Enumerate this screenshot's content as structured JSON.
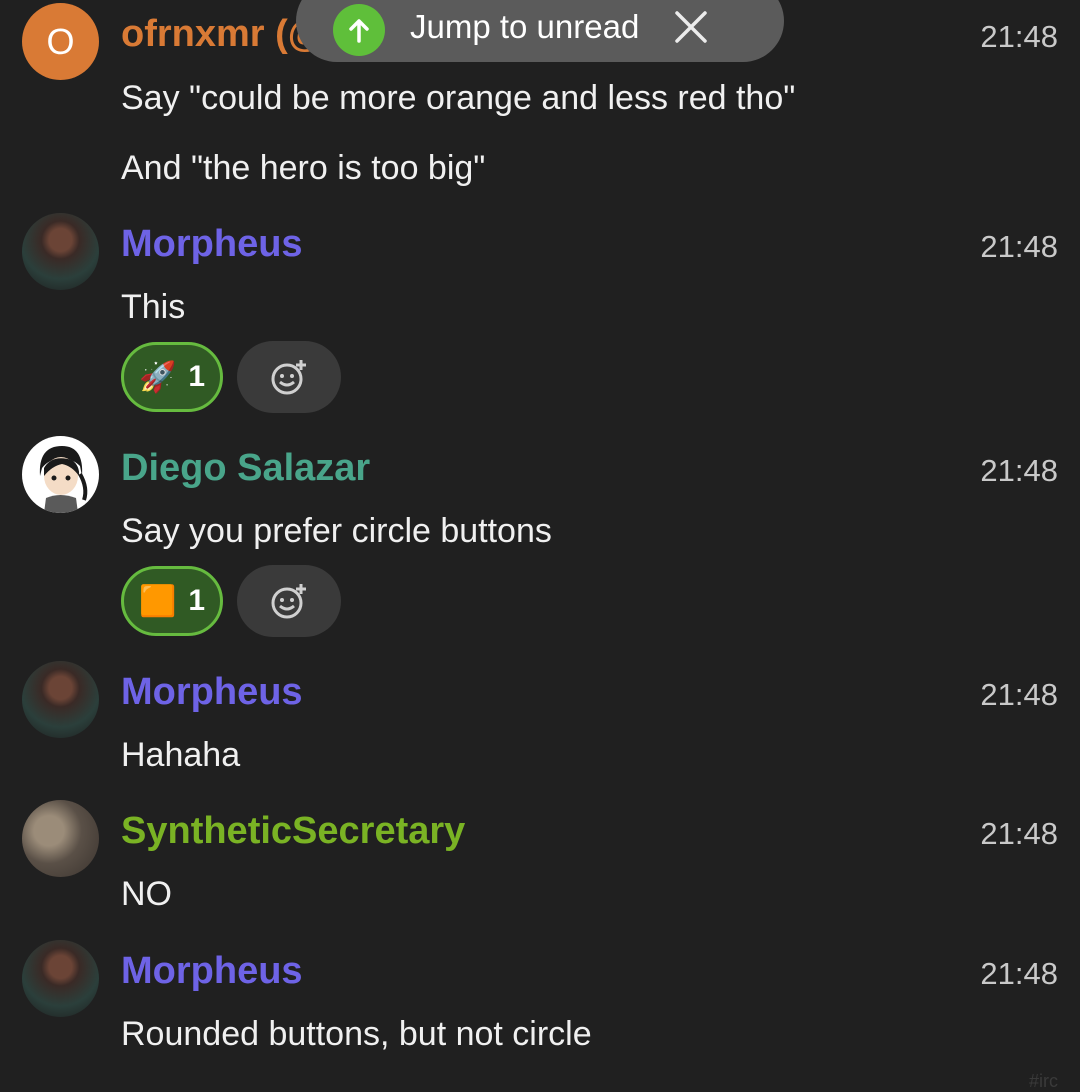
{
  "jump_banner": {
    "label": "Jump to unread"
  },
  "messages": [
    {
      "avatar_initial": "O",
      "sender": "ofrnxmr (@",
      "sender_color": "#d97a35",
      "time": "21:48",
      "lines": [
        "Say \"could be more orange and less red tho\"",
        "And \"the hero is too big\""
      ]
    },
    {
      "sender": "Morpheus",
      "sender_color": "#6e63e6",
      "time": "21:48",
      "lines": [
        "This"
      ],
      "reaction": {
        "emoji": "🚀",
        "count": "1"
      }
    },
    {
      "sender": "Diego Salazar",
      "sender_color": "#49a58a",
      "time": "21:48",
      "lines": [
        "Say you prefer circle buttons"
      ],
      "reaction": {
        "emoji": "🟧",
        "count": "1"
      }
    },
    {
      "sender": "Morpheus",
      "sender_color": "#6e63e6",
      "time": "21:48",
      "lines": [
        "Hahaha"
      ]
    },
    {
      "sender": "SyntheticSecretary",
      "sender_color": "#7ab324",
      "time": "21:48",
      "lines": [
        "NO"
      ]
    },
    {
      "sender": "Morpheus",
      "sender_color": "#6e63e6",
      "time": "21:48",
      "lines": [
        "Rounded buttons, but not circle"
      ]
    }
  ],
  "channel_tag": "#irc",
  "colors": {
    "background": "#202020",
    "reaction_border": "#66bb3f",
    "reaction_fill": "#305a24",
    "jump_pill": "#5b5b5b"
  }
}
